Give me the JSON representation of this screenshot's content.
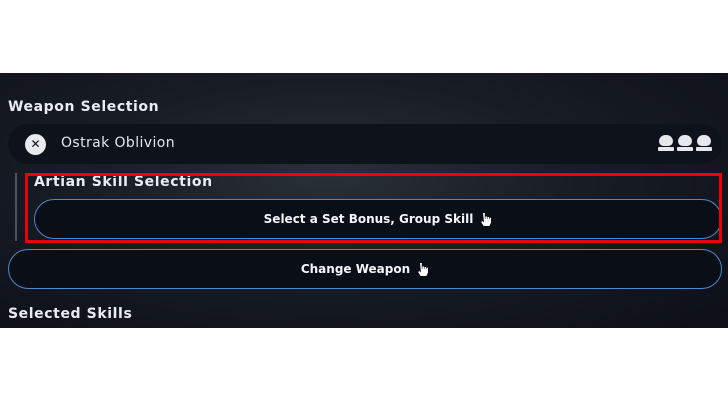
{
  "weapon_selection": {
    "title": "Weapon Selection",
    "weapon_name": "Ostrak Oblivion",
    "remove_icon": "close-icon",
    "tier_icons": [
      "trophy-icon",
      "trophy-icon",
      "trophy-icon"
    ]
  },
  "artian_skill": {
    "title": "Artian Skill Selection",
    "button_label": "Select a Set Bonus, Group Skill"
  },
  "change_weapon": {
    "button_label": "Change Weapon"
  },
  "selected_skills": {
    "title": "Selected Skills"
  },
  "colors": {
    "accent_border": "#4f88cc",
    "highlight": "#e8000c",
    "panel_bg": "#0c0f17"
  }
}
